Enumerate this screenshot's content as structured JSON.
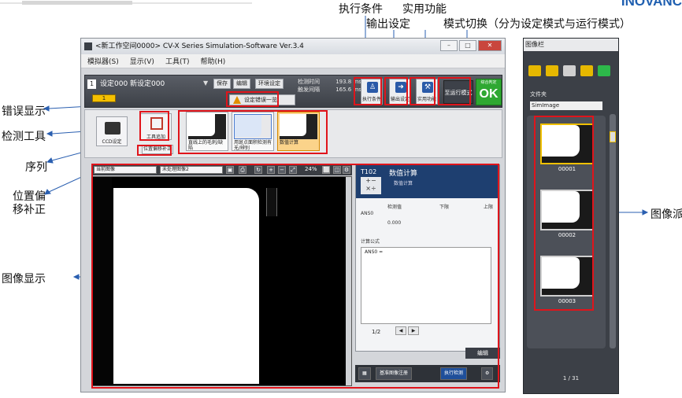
{
  "callouts": {
    "exec_cond": "执行条件",
    "output_set": "输出设定",
    "utility": "实用功能",
    "mode_switch": "模式切换（分为设定模式与运行模式）",
    "error_display": "错误显示",
    "detect_tool": "检测工具",
    "sequence": "序列",
    "pos_offset": "位置偏\n移补正",
    "image_display": "图像显示",
    "image_bar": "图像派"
  },
  "brand": "INOVANC",
  "window": {
    "title": "<新工作空间0000> CV-X Series Simulation-Software Ver.3.4",
    "menu": [
      "模拟器(S)",
      "显示(V)",
      "工具(T)",
      "帮助(H)"
    ]
  },
  "setbar": {
    "setting_num": "1",
    "setting_name": "设定000  新设定000",
    "save": "保存",
    "edit": "编辑",
    "env": "环境设定",
    "detect_time_label": "检测时间",
    "detect_time_value": "193.8",
    "trigger_label": "触发间隔",
    "trigger_value": "165.6",
    "unit": "ms",
    "exec_btn": "执行条件",
    "output_btn": "输出设定",
    "util_btn": "实用功能",
    "mode_btn": "至运行模式",
    "judge_label": "综合判定",
    "ok": "OK",
    "cam_tab": "1",
    "err_btn": "设定错误一览"
  },
  "strip": {
    "ccd": "CCD设定",
    "add_tool": "工具追加",
    "pos_btn": "位置偏移补正",
    "tools": [
      {
        "label": "直线上的毛刺/缺陷"
      },
      {
        "label": "用斑点面积检测有无/辨别"
      },
      {
        "label": "数值计算"
      }
    ]
  },
  "imgbar": {
    "view_select": "当前图像",
    "image_select": "未处理图像2",
    "zoom": "24%"
  },
  "toolpanel": {
    "id": "T102",
    "name": "数值计算",
    "sub": "数值计算",
    "header_cols": [
      "检测值",
      "下限",
      "上限"
    ],
    "row_name": "ANS0",
    "row_value": "0.000",
    "formula_label": "计算公式",
    "formula": "ANS0 =",
    "page": "1/2",
    "edit": "编辑",
    "register": "基准图像注册",
    "run": "执行检测"
  },
  "side": {
    "title": "图像栏",
    "folder_label": "文件夹",
    "folder_value": "SimImage",
    "thumbs": [
      "00001",
      "00002",
      "00003"
    ],
    "page": "1  /  31"
  }
}
